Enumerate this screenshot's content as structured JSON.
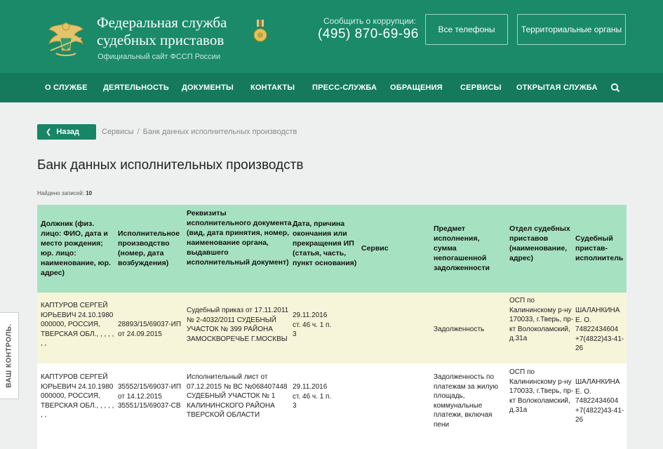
{
  "header": {
    "title_line1": "Федеральная служба",
    "title_line2": "судебных приставов",
    "subtitle": "Официальный сайт ФССП России",
    "corruption_label": "Сообщить о коррупции:",
    "corruption_phone": "(495) 870-69-96",
    "phones_button": "Все телефоны",
    "regions_button": "Территориальные органы",
    "brand_color": "#1a8a69"
  },
  "nav": {
    "items": [
      "О СЛУЖБЕ",
      "ДЕЯТЕЛЬНОСТЬ",
      "ДОКУМЕНТЫ",
      "КОНТАКТЫ",
      "ПРЕСС-СЛУЖБА",
      "ОБРАЩЕНИЯ",
      "СЕРВИСЫ",
      "ОТКРЫТАЯ СЛУЖБА"
    ],
    "search_icon": "search-icon"
  },
  "back_button": "Назад",
  "breadcrumb": {
    "items": [
      "Сервисы",
      "Банк данных исполнительных производств"
    ],
    "separator": "/"
  },
  "page_title": "Банк данных исполнительных производств",
  "found": {
    "label": "Найдено записей:",
    "count": "10"
  },
  "table": {
    "columns": [
      "Должник (физ. лицо: ФИО, дата и место рождения; юр. лицо: наименование, юр. адрес)",
      "Исполнительное производство (номер, дата возбуждения)",
      "Реквизиты исполнительного документа (вид, дата принятия, номер, наименование органа, выдавшего исполнительный документ)",
      "Дата, причина окончания или прекращения ИП (статья, часть, пункт основания)",
      "Сервис",
      "Предмет исполнения, сумма непогашенной задолженности",
      "Отдел судебных приставов (наименование, адрес)",
      "Судебный пристав-исполнитель"
    ],
    "rows": [
      {
        "debtor": "КАПТУРОВ СЕРГЕЙ ЮРЬЕВИЧ 24.10.1980 000000, РОССИЯ, ТВЕРСКАЯ ОБЛ., , , , , , ,",
        "proceeding": "28893/15/69037-ИП от 24.09.2015",
        "document": "Судебный приказ от 17.11.2011 № 2-4032/2011 СУДЕБНЫЙ УЧАСТОК № 399 РАЙОНА ЗАМОСКВОРЕЧЬЕ Г.МОСКВЫ",
        "end_date": "29.11.2016 ст. 46 ч. 1 п. 3",
        "service": "",
        "subject": "Задолженность",
        "department": "ОСП по Калининскому р-ну 170033, г.Тверь, пр-кт Волоколамский, д.31а",
        "bailiff": "ШАЛАНКИНА Е. О. 74822434604 +7(4822)43-41-26"
      },
      {
        "debtor": "КАПТУРОВ СЕРГЕЙ ЮРЬЕВИЧ 24.10.1980 000000, РОССИЯ, ТВЕРСКАЯ ОБЛ., , , , , , ,",
        "proceeding": "35552/15/69037-ИП от 14.12.2015 35551/15/69037-СВ",
        "document": "Исполнительный лист от 07.12.2015 № ВС №068407448 СУДЕБНЫЙ УЧАСТОК № 1 КАЛИНИНСКОГО РАЙОНА ТВЕРСКОЙ ОБЛАСТИ",
        "end_date": "29.11.2016 ст. 46 ч. 1 п. 3",
        "service": "",
        "subject": "Задолженность по платежам за жилую площадь, коммунальные платежи, включая пени",
        "department": "ОСП по Калининскому р-ну 170033, г.Тверь, пр-кт Волоколамский, д.31а",
        "bailiff": "ШАЛАНКИНА Е. О. 74822434604 +7(4822)43-41-26"
      }
    ]
  },
  "side_tab": "ВАШ КОНТРОЛЬ."
}
